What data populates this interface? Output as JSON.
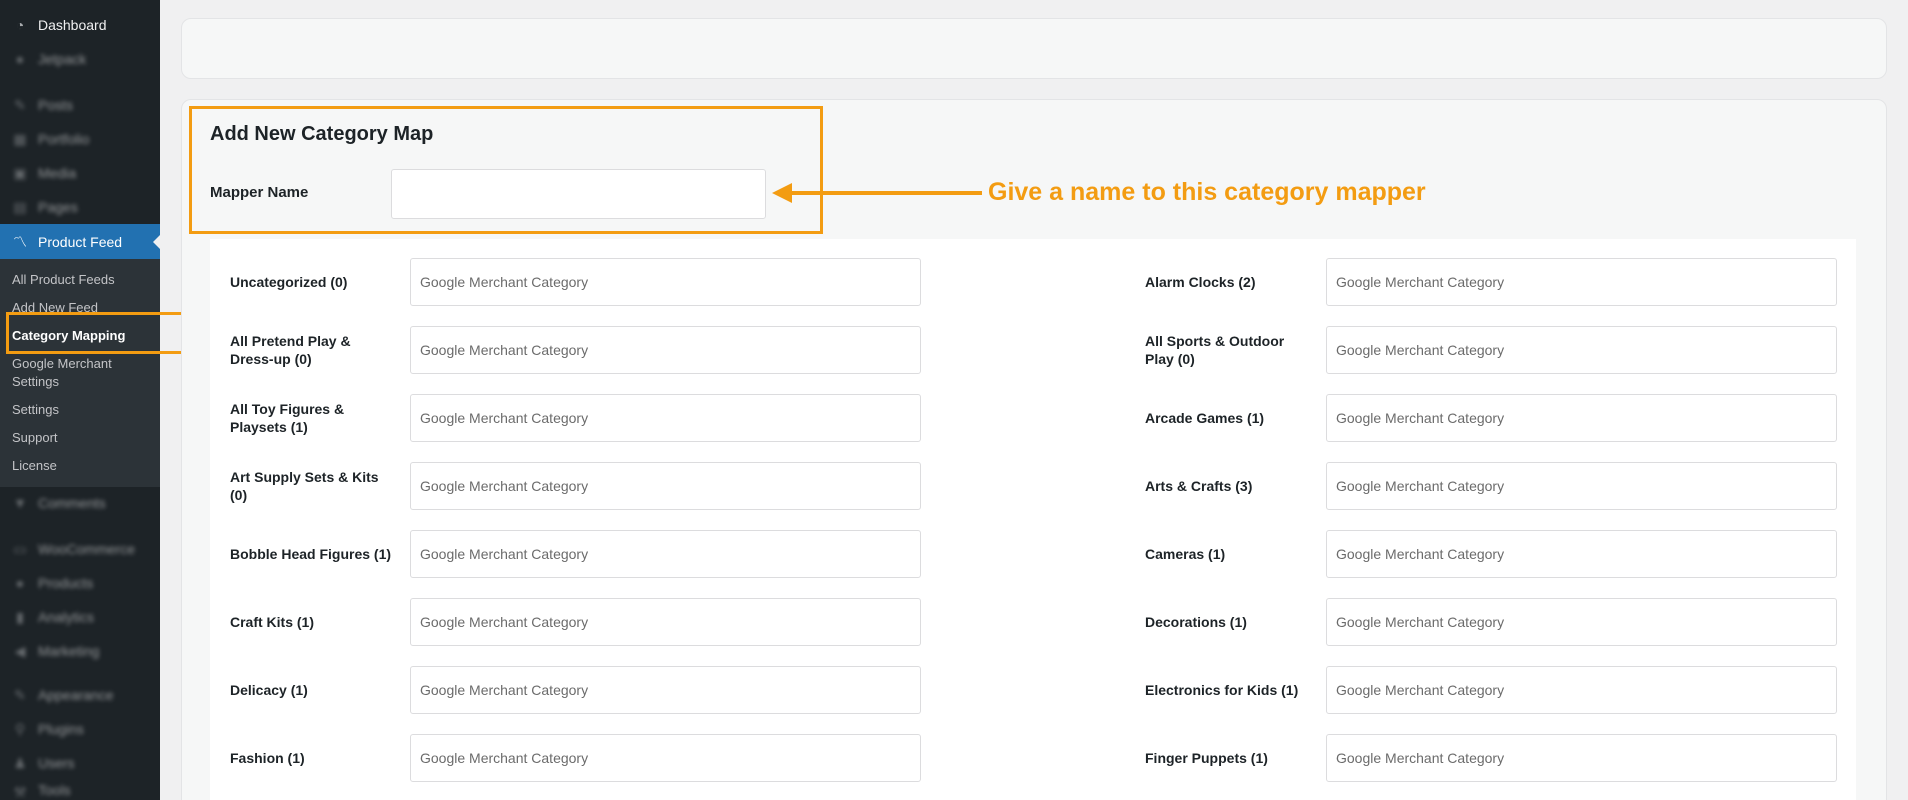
{
  "sidebar": {
    "items": [
      {
        "label": "Dashboard",
        "icon": "dashboard-icon",
        "glyph": "◔"
      },
      {
        "label": "Jetpack",
        "icon": "jetpack-icon",
        "glyph": "●"
      },
      {
        "label": "Posts",
        "icon": "pin-icon",
        "glyph": "✎"
      },
      {
        "label": "Portfolio",
        "icon": "portfolio-icon",
        "glyph": "▦"
      },
      {
        "label": "Media",
        "icon": "media-icon",
        "glyph": "▣"
      },
      {
        "label": "Pages",
        "icon": "pages-icon",
        "glyph": "▤"
      },
      {
        "label": "Product Feed",
        "icon": "chart-line-icon",
        "glyph": "〽"
      },
      {
        "label": "Comments",
        "icon": "comments-icon",
        "glyph": "▼"
      },
      {
        "label": "WooCommerce",
        "icon": "woocommerce-icon",
        "glyph": "▭"
      },
      {
        "label": "Products",
        "icon": "products-icon",
        "glyph": "●"
      },
      {
        "label": "Analytics",
        "icon": "analytics-icon",
        "glyph": "▮"
      },
      {
        "label": "Marketing",
        "icon": "marketing-icon",
        "glyph": "◀"
      },
      {
        "label": "Appearance",
        "icon": "appearance-icon",
        "glyph": "✎"
      },
      {
        "label": "Plugins",
        "icon": "plugins-icon",
        "glyph": "⚲"
      },
      {
        "label": "Users",
        "icon": "users-icon",
        "glyph": "♟"
      },
      {
        "label": "Tools",
        "icon": "tools-icon",
        "glyph": "⚒"
      }
    ],
    "submenu": [
      "All Product Feeds",
      "Add New Feed",
      "Category Mapping",
      "Google Merchant Settings",
      "Settings",
      "Support",
      "License"
    ]
  },
  "form": {
    "title": "Add New Category Map",
    "mapper_label": "Mapper Name",
    "mapper_value": ""
  },
  "annotation": {
    "text": "Give a name to this category mapper",
    "color": "#f39c12"
  },
  "categories": {
    "placeholder": "Google Merchant Category",
    "left": [
      "Uncategorized (0)",
      "All Pretend Play & Dress-up (0)",
      "All Toy Figures & Playsets (1)",
      "Art Supply Sets & Kits (0)",
      "Bobble Head Figures (1)",
      "Craft Kits (1)",
      "Delicacy (1)",
      "Fashion (1)"
    ],
    "right": [
      "Alarm Clocks (2)",
      "All Sports & Outdoor Play (0)",
      "Arcade Games (1)",
      "Arts & Crafts (3)",
      "Cameras (1)",
      "Decorations (1)",
      "Electronics for Kids (1)",
      "Finger Puppets (1)"
    ]
  }
}
